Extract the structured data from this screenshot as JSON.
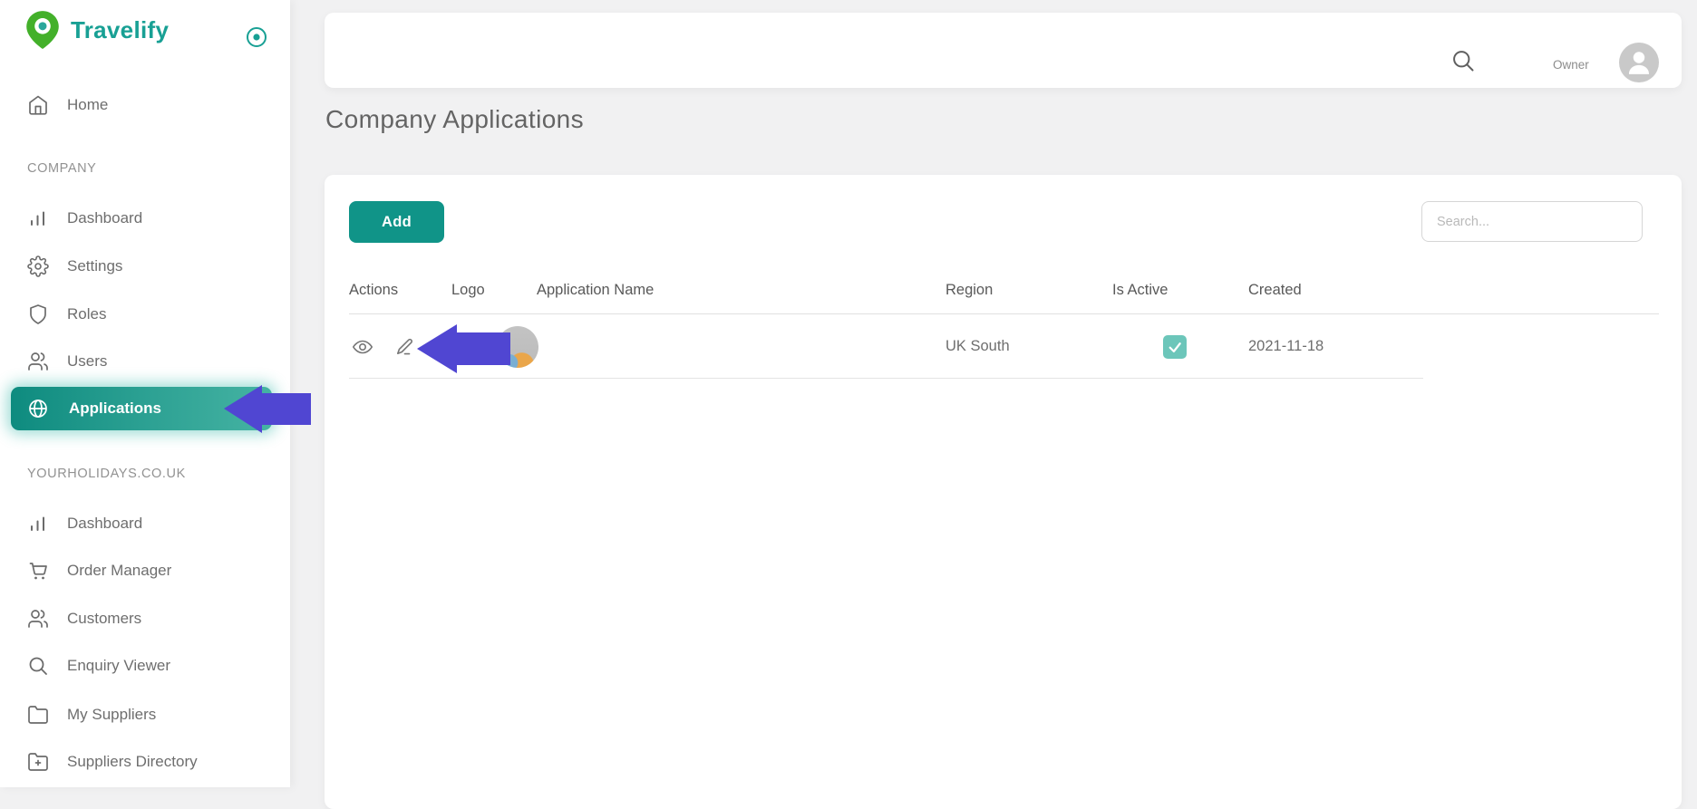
{
  "brand": {
    "name": "Travelify"
  },
  "sidebar": {
    "top_items": [
      {
        "label": "Home",
        "icon": "home-icon"
      }
    ],
    "sections": [
      {
        "label": "COMPANY",
        "items": [
          {
            "label": "Dashboard",
            "icon": "bar-chart-icon"
          },
          {
            "label": "Settings",
            "icon": "gear-icon"
          },
          {
            "label": "Roles",
            "icon": "shield-icon"
          },
          {
            "label": "Users",
            "icon": "users-icon"
          },
          {
            "label": "Applications",
            "icon": "globe-icon",
            "active": true
          }
        ]
      },
      {
        "label": "YOURHOLIDAYS.CO.UK",
        "items": [
          {
            "label": "Dashboard",
            "icon": "bar-chart-icon"
          },
          {
            "label": "Order Manager",
            "icon": "cart-icon"
          },
          {
            "label": "Customers",
            "icon": "users-icon"
          },
          {
            "label": "Enquiry Viewer",
            "icon": "search-icon"
          },
          {
            "label": "My Suppliers",
            "icon": "folder-icon"
          },
          {
            "label": "Suppliers Directory",
            "icon": "folder-plus-icon"
          }
        ]
      }
    ]
  },
  "topbar": {
    "user_role": "Owner"
  },
  "page": {
    "title": "Company Applications"
  },
  "toolbar": {
    "add_label": "Add",
    "search_placeholder": "Search..."
  },
  "table": {
    "columns": [
      "Actions",
      "Logo",
      "Application Name",
      "Region",
      "Is Active",
      "Created"
    ],
    "rows": [
      {
        "application_name": "",
        "region": "UK South",
        "is_active": true,
        "created": "2021-11-18"
      }
    ]
  },
  "colors": {
    "brand_teal": "#18a094",
    "logo_green": "#43b02a",
    "accent_teal": "#109488",
    "active_gradient_start": "#0e8b7f",
    "active_gradient_end": "#45b3a3",
    "checkbox_teal": "#6cc6ba",
    "annotation_arrow": "#5046d2"
  }
}
